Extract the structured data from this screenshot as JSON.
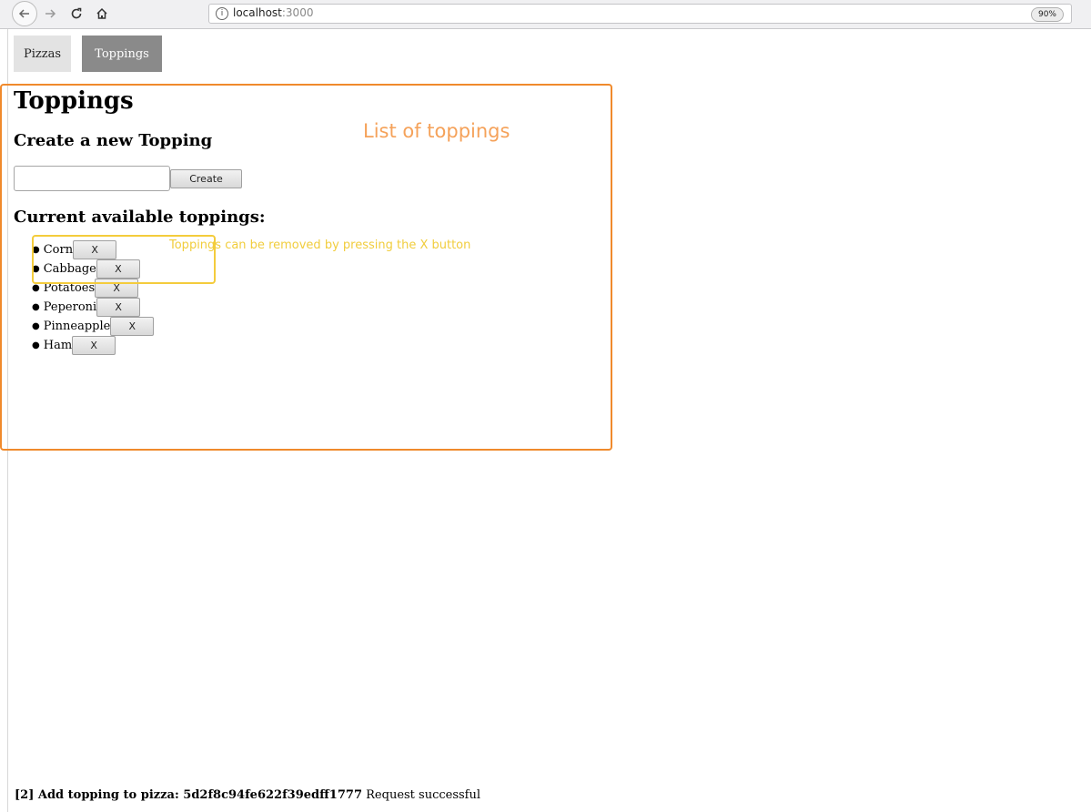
{
  "browser": {
    "url_host": "localhost",
    "url_port": ":3000",
    "zoom": "90%",
    "info_glyph": "i"
  },
  "nav": {
    "pizzas_label": "Pizzas",
    "toppings_label": "Toppings",
    "active": "Toppings"
  },
  "page": {
    "title": "Toppings",
    "create_heading": "Create a new Topping",
    "create_input_value": "",
    "create_button_label": "Create",
    "list_heading": "Current available toppings:",
    "toppings": [
      {
        "name": "Corn",
        "remove_label": "X"
      },
      {
        "name": "Cabbage",
        "remove_label": "X"
      },
      {
        "name": "Potatoes",
        "remove_label": "X"
      },
      {
        "name": "Peperoni",
        "remove_label": "X"
      },
      {
        "name": "Pinneapple",
        "remove_label": "X"
      },
      {
        "name": "Ham",
        "remove_label": "X"
      }
    ]
  },
  "annotations": {
    "list_label": "List of toppings",
    "remove_hint": "Toppings can be removed by pressing the X button",
    "list_color": "#f08a2c",
    "hint_color": "#f4cc3c"
  },
  "status": {
    "prefix": "[2] Add topping to pizza: 5d2f8c94fe622f39edff1777",
    "message": "Request successful"
  }
}
